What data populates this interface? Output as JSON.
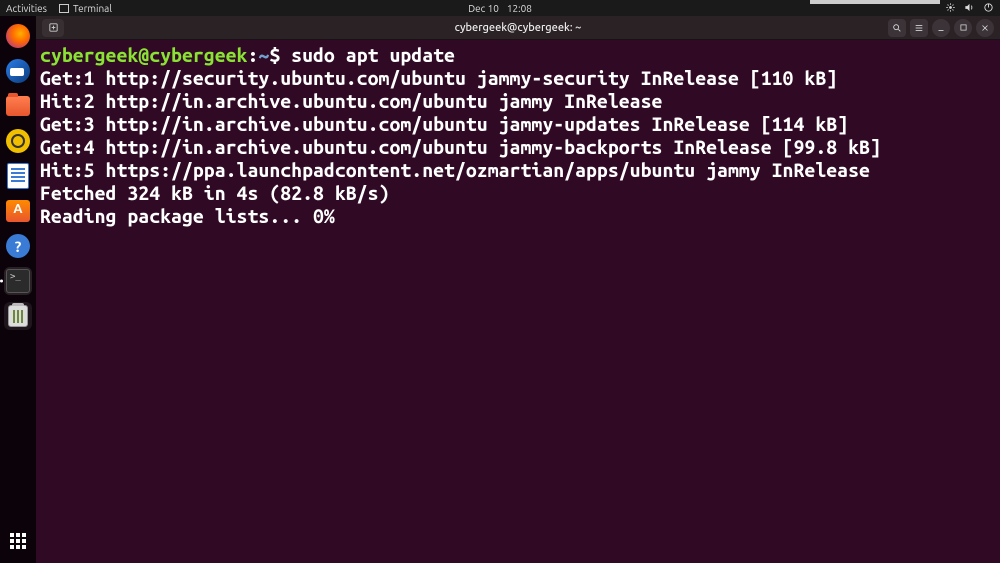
{
  "topbar": {
    "activities": "Activities",
    "app_indicator_label": "Terminal",
    "date": "Dec 10",
    "time": "12:08"
  },
  "dock": {
    "items": [
      {
        "name": "firefox",
        "label": "Firefox"
      },
      {
        "name": "thunderbird",
        "label": "Thunderbird"
      },
      {
        "name": "files",
        "label": "Files"
      },
      {
        "name": "rhythmbox",
        "label": "Rhythmbox"
      },
      {
        "name": "writer",
        "label": "LibreOffice Writer"
      },
      {
        "name": "software",
        "label": "Ubuntu Software"
      },
      {
        "name": "help",
        "label": "Help"
      },
      {
        "name": "terminal",
        "label": "Terminal"
      },
      {
        "name": "trash",
        "label": "Trash"
      }
    ],
    "apps_label": "Show Applications"
  },
  "window": {
    "title": "cybergeek@cybergeek: ~"
  },
  "terminal": {
    "prompt_user": "cybergeek@cybergeek",
    "prompt_sep1": ":",
    "prompt_path": "~",
    "prompt_sep2": "$ ",
    "command": "sudo apt update",
    "output": [
      "Get:1 http://security.ubuntu.com/ubuntu jammy-security InRelease [110 kB]",
      "Hit:2 http://in.archive.ubuntu.com/ubuntu jammy InRelease",
      "Get:3 http://in.archive.ubuntu.com/ubuntu jammy-updates InRelease [114 kB]",
      "Get:4 http://in.archive.ubuntu.com/ubuntu jammy-backports InRelease [99.8 kB]",
      "Hit:5 https://ppa.launchpadcontent.net/ozmartian/apps/ubuntu jammy InRelease",
      "Fetched 324 kB in 4s (82.8 kB/s)",
      "Reading package lists... 0%"
    ]
  }
}
